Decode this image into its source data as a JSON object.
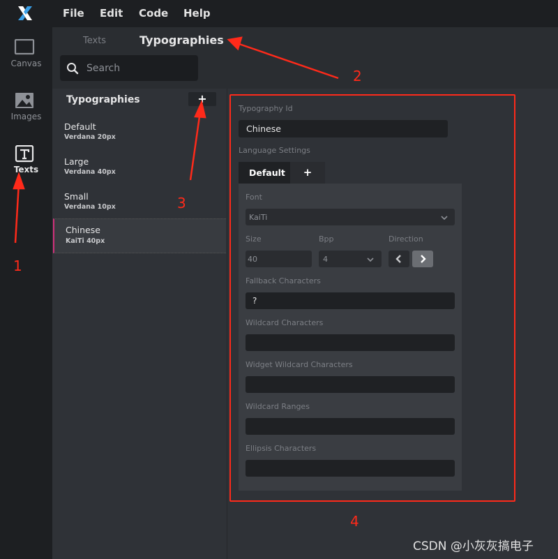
{
  "app": {
    "logo_icon": "x-logo-icon",
    "menu": [
      "File",
      "Edit",
      "Code",
      "Help"
    ]
  },
  "rail": {
    "items": [
      {
        "label": "Canvas",
        "icon": "canvas-icon"
      },
      {
        "label": "Images",
        "icon": "image-icon"
      },
      {
        "label": "Texts",
        "icon": "text-icon"
      }
    ]
  },
  "header": {
    "tabs": [
      {
        "label": "Texts"
      },
      {
        "label": "Typographies"
      }
    ],
    "search_placeholder": "Search"
  },
  "list": {
    "title": "Typographies",
    "add_label": "+",
    "items": [
      {
        "name": "Default",
        "meta": "Verdana  20px"
      },
      {
        "name": "Large",
        "meta": "Verdana  40px"
      },
      {
        "name": "Small",
        "meta": "Verdana  10px"
      },
      {
        "name": "Chinese",
        "meta": "KaiTi  40px"
      }
    ]
  },
  "detail": {
    "typography_id_label": "Typography Id",
    "typography_id_value": "Chinese",
    "language_settings_label": "Language Settings",
    "lang_tabs": [
      "Default",
      "+"
    ],
    "font_label": "Font",
    "font_value": "KaiTi",
    "size_label": "Size",
    "size_value": "40",
    "bpp_label": "Bpp",
    "bpp_value": "4",
    "direction_label": "Direction",
    "fallback_label": "Fallback Characters",
    "fallback_value": "?",
    "wildcard_label": "Wildcard Characters",
    "widget_wildcard_label": "Widget Wildcard Characters",
    "wildcard_ranges_label": "Wildcard Ranges",
    "ellipsis_label": "Ellipsis Characters"
  },
  "annotations": {
    "colors": {
      "red": "#ff2a1a"
    },
    "numbers": [
      "1",
      "2",
      "3",
      "4"
    ]
  },
  "watermark": "CSDN @小灰灰搞电子"
}
